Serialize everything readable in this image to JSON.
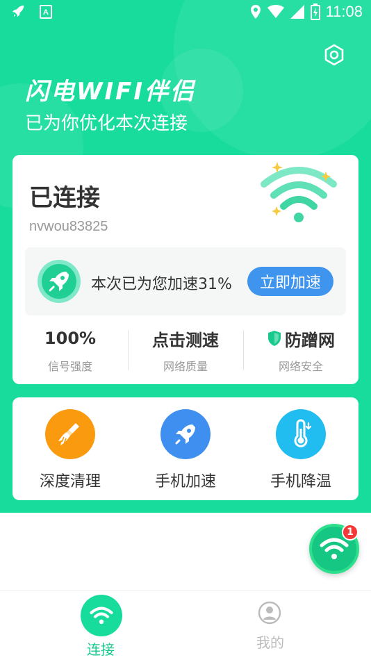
{
  "status_bar": {
    "time": "11:08"
  },
  "header": {
    "app_title": "闪电WIFI伴侣",
    "subtitle": "已为你优化本次连接"
  },
  "connection": {
    "status": "已连接",
    "ssid": "nvwou83825",
    "boost_text": "本次已为您加速31%",
    "boost_button": "立即加速"
  },
  "stats": [
    {
      "value": "100%",
      "label": "信号强度"
    },
    {
      "value": "点击测速",
      "label": "网络质量"
    },
    {
      "value": "防蹭网",
      "label": "网络安全"
    }
  ],
  "tools": [
    {
      "label": "深度清理",
      "icon": "broom-icon",
      "color": "#fa9a0f"
    },
    {
      "label": "手机加速",
      "icon": "rocket-icon",
      "color": "#3f8ff0"
    },
    {
      "label": "手机降温",
      "icon": "thermometer-icon",
      "color": "#22bdf0"
    }
  ],
  "fab": {
    "badge_count": "1"
  },
  "tabbar": {
    "tabs": [
      {
        "label": "连接",
        "active": true
      },
      {
        "label": "我的",
        "active": false
      }
    ]
  },
  "colors": {
    "brand_green": "#17dc9c",
    "accent_blue": "#3f94ee",
    "badge_red": "#f43838"
  }
}
